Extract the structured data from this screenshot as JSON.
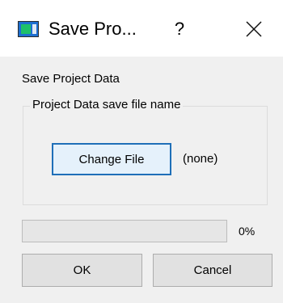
{
  "window": {
    "title": "Save Pro...",
    "icon": "app-window-icon",
    "help_label": "?",
    "close_icon": "close-icon"
  },
  "dialog": {
    "section_title": "Save Project Data",
    "group_label": "Project Data save file name",
    "change_file_label": "Change File",
    "file_value": "(none)",
    "progress_percent": 0,
    "progress_text": "0%",
    "ok_label": "OK",
    "cancel_label": "Cancel"
  },
  "colors": {
    "accent": "#1f6fb8",
    "dialog_bg": "#f0f0f0"
  }
}
